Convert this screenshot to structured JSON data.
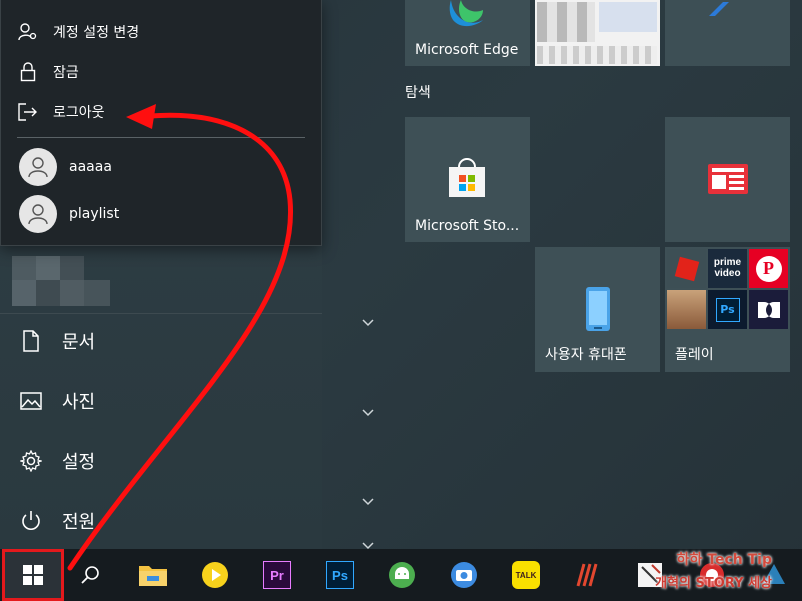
{
  "account_menu": {
    "change_settings": "계정 설정 변경",
    "lock": "잠금",
    "sign_out": "로그아웃",
    "users": [
      {
        "name": "aaaaa"
      },
      {
        "name": "playlist"
      }
    ]
  },
  "rail": {
    "documents": "문서",
    "pictures": "사진",
    "settings": "설정",
    "power": "전원"
  },
  "tiles": {
    "edge": "Microsoft Edge",
    "explore_group": "탐색",
    "store": "Microsoft Sto...",
    "your_phone": "사용자 휴대폰",
    "play": "플레이",
    "prime_video_line1": "prime",
    "prime_video_line2": "video",
    "ps_label": "Ps"
  },
  "taskbar": {
    "premiere_label": "Pr",
    "photoshop_label": "Ps",
    "kakaotalk_label": "TALK"
  },
  "watermark": {
    "line1": "하하 Tech Tip",
    "line2": "개혁의 STORY 세상"
  },
  "colors": {
    "highlight": "#e4191c",
    "annotation_arrow": "#ff0f0f"
  }
}
